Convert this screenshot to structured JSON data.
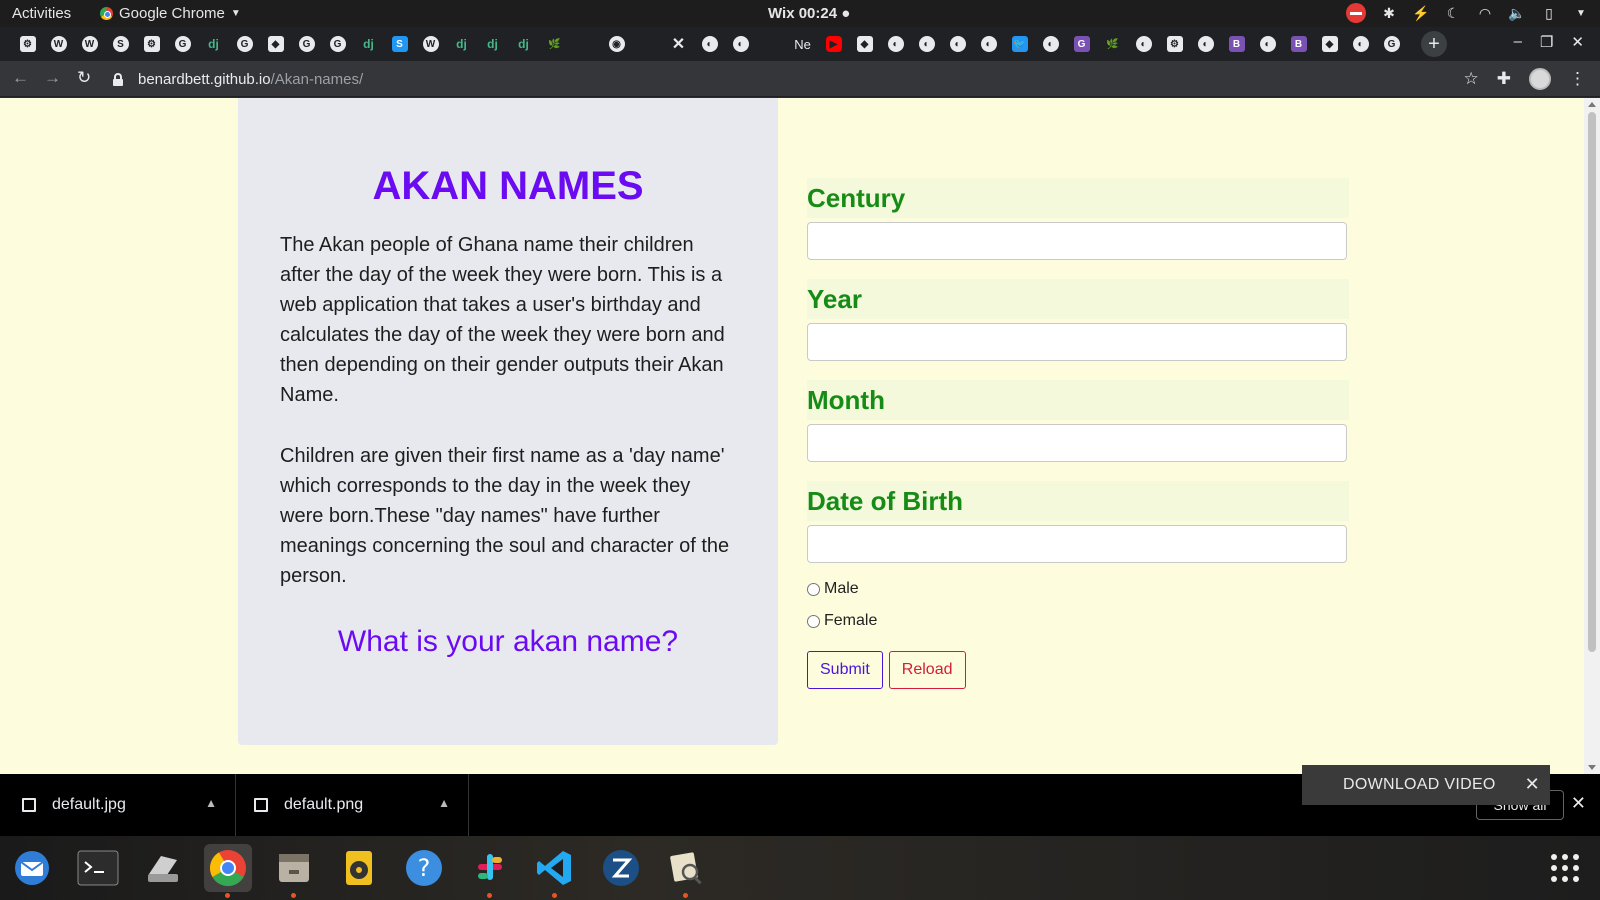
{
  "system_bar": {
    "activities": "Activities",
    "app_name": "Google Chrome",
    "clock": "Wix 00:24 ●"
  },
  "browser": {
    "tabs": [
      {
        "icon": "settings-icon",
        "glyph": "⚙"
      },
      {
        "icon": "wordpress-icon",
        "glyph": "W"
      },
      {
        "icon": "wordpress-icon",
        "glyph": "W"
      },
      {
        "icon": "stackoverflow-icon",
        "glyph": "S"
      },
      {
        "icon": "settings-icon",
        "glyph": "⚙"
      },
      {
        "icon": "google-icon",
        "glyph": "G"
      },
      {
        "icon": "django-icon",
        "glyph": "dj"
      },
      {
        "icon": "google-icon",
        "glyph": "G"
      },
      {
        "icon": "cube-icon",
        "glyph": "◆"
      },
      {
        "icon": "google-icon",
        "glyph": "G"
      },
      {
        "icon": "google-icon",
        "glyph": "G"
      },
      {
        "icon": "django-icon",
        "glyph": "dj"
      },
      {
        "icon": "s-icon",
        "glyph": "S"
      },
      {
        "icon": "wordpress-icon",
        "glyph": "W"
      },
      {
        "icon": "django-icon",
        "glyph": "dj"
      },
      {
        "icon": "django-icon",
        "glyph": "dj"
      },
      {
        "icon": "django-icon",
        "glyph": "dj"
      },
      {
        "icon": "leaf-icon",
        "glyph": "🌿"
      },
      {
        "icon": "blank-icon",
        "glyph": ""
      },
      {
        "icon": "github-icon",
        "glyph": "◉"
      },
      {
        "icon": "blank-icon",
        "glyph": ""
      },
      {
        "icon": "close-icon",
        "glyph": "✕"
      },
      {
        "icon": "globe-icon",
        "glyph": "◐"
      },
      {
        "icon": "globe-icon",
        "glyph": "◐"
      },
      {
        "icon": "blank-icon",
        "glyph": ""
      },
      {
        "icon": "ne-icon",
        "glyph": "Ne"
      },
      {
        "icon": "youtube-icon",
        "glyph": "▶"
      },
      {
        "icon": "cube-icon",
        "glyph": "◆"
      },
      {
        "icon": "globe-icon",
        "glyph": "◐"
      },
      {
        "icon": "globe-icon",
        "glyph": "◐"
      },
      {
        "icon": "globe-icon",
        "glyph": "◐"
      },
      {
        "icon": "globe-icon",
        "glyph": "◐"
      },
      {
        "icon": "twitter-icon",
        "glyph": "🐦"
      },
      {
        "icon": "globe-icon",
        "glyph": "◐"
      },
      {
        "icon": "g-icon",
        "glyph": "G"
      },
      {
        "icon": "leaf-icon",
        "glyph": "🌿"
      },
      {
        "icon": "globe-icon",
        "glyph": "◐"
      },
      {
        "icon": "settings-icon",
        "glyph": "⚙"
      },
      {
        "icon": "globe-icon",
        "glyph": "◐"
      },
      {
        "icon": "bootstrap-icon",
        "glyph": "B"
      },
      {
        "icon": "globe-icon",
        "glyph": "◐"
      },
      {
        "icon": "bootstrap-icon",
        "glyph": "B"
      },
      {
        "icon": "cube-icon",
        "glyph": "◆"
      },
      {
        "icon": "globe-icon",
        "glyph": "◐"
      },
      {
        "icon": "google-icon",
        "glyph": "G"
      }
    ],
    "url_host": "benardbett.github.io",
    "url_path": "/Akan-names/"
  },
  "page": {
    "title": "AKAN NAMES",
    "paragraph1": "The Akan people of Ghana name their children after the day of the week they were born. This is a web application that takes a user's birthday and calculates the day of the week they were born and then depending on their gender outputs their Akan Name.",
    "paragraph2": "Children are given their first name as a 'day name' which corresponds to the day in the week they were born.These \"day names\" have further meanings concerning the soul and character of the person.",
    "question": "What is your akan name?",
    "form": {
      "century_label": "Century",
      "year_label": "Year",
      "month_label": "Month",
      "dob_label": "Date of Birth",
      "male_label": "Male",
      "female_label": "Female",
      "submit_label": "Submit",
      "reload_label": "Reload"
    },
    "colors": {
      "title": "#6a0bf2",
      "label": "#168c16",
      "background": "#fdfdde"
    }
  },
  "downloads": {
    "items": [
      "default.jpg",
      "default.png"
    ],
    "show_all": "Show all"
  },
  "overlay": {
    "download_video": "DOWNLOAD VIDEO"
  },
  "dock": {
    "apps": [
      "thunderbird-icon",
      "terminal-icon",
      "scanner-icon",
      "chrome-icon",
      "files-icon",
      "rhythmbox-icon",
      "help-icon",
      "slack-icon",
      "vscode-icon",
      "zeal-icon",
      "gimp-icon"
    ]
  }
}
